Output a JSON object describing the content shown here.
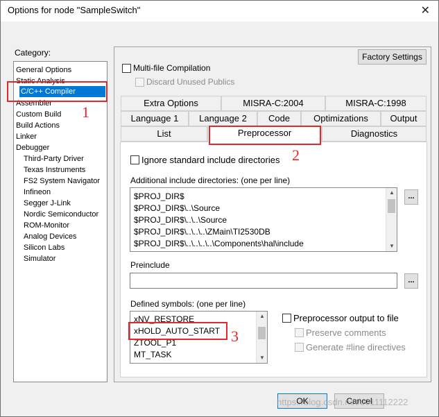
{
  "window": {
    "title": "Options for node \"SampleSwitch\""
  },
  "category": {
    "label": "Category:",
    "items": [
      {
        "label": "General Options"
      },
      {
        "label": "Static Analysis"
      },
      {
        "label": "C/C++ Compiler"
      },
      {
        "label": "Assembler"
      },
      {
        "label": "Custom Build"
      },
      {
        "label": "Build Actions"
      },
      {
        "label": "Linker"
      },
      {
        "label": "Debugger"
      },
      {
        "label": "Third-Party Driver"
      },
      {
        "label": "Texas Instruments"
      },
      {
        "label": "FS2 System Navigator"
      },
      {
        "label": "Infineon"
      },
      {
        "label": "Segger J-Link"
      },
      {
        "label": "Nordic Semiconductor"
      },
      {
        "label": "ROM-Monitor"
      },
      {
        "label": "Analog Devices"
      },
      {
        "label": "Silicon Labs"
      },
      {
        "label": "Simulator"
      }
    ],
    "selected": "C/C++ Compiler"
  },
  "factory_settings": "Factory Settings",
  "multi_file": {
    "label": "Multi-file Compilation",
    "checked": false
  },
  "discard_publics": {
    "label": "Discard Unused Publics",
    "checked": false
  },
  "tabs": {
    "row1": [
      "Extra Options",
      "MISRA-C:2004",
      "MISRA-C:1998"
    ],
    "row2": [
      "Language 1",
      "Language 2",
      "Code",
      "Optimizations",
      "Output"
    ],
    "row3": [
      "List",
      "Preprocessor",
      "Diagnostics"
    ],
    "active": "Preprocessor"
  },
  "preprocessor": {
    "ignore_std": {
      "label": "Ignore standard include directories",
      "checked": false
    },
    "include_label": "Additional include directories: (one per line)",
    "include_dirs": [
      "$PROJ_DIR$",
      "$PROJ_DIR$\\..\\Source",
      "$PROJ_DIR$\\..\\..\\Source",
      "$PROJ_DIR$\\..\\..\\..\\ZMain\\TI2530DB",
      "$PROJ_DIR$\\..\\..\\..\\..\\Components\\hal\\include"
    ],
    "preinclude_label": "Preinclude",
    "preinclude_value": "",
    "defined_label": "Defined symbols: (one per line)",
    "defined_symbols": [
      "xNV_RESTORE",
      "xHOLD_AUTO_START",
      "ZTOOL_P1",
      "MT_TASK"
    ],
    "output_to_file": {
      "label": "Preprocessor output to file",
      "checked": false
    },
    "preserve_comments": {
      "label": "Preserve comments",
      "checked": false
    },
    "generate_line": {
      "label": "Generate #line directives",
      "checked": false
    },
    "ellipsis": "..."
  },
  "buttons": {
    "ok": "OK",
    "cancel": "Cancel"
  },
  "annotations": [
    "1",
    "2",
    "3"
  ],
  "watermark": "https://blog.csdn.net/u011112222",
  "colors": {
    "selection": "#0078d7",
    "annotation": "#e8262a"
  }
}
